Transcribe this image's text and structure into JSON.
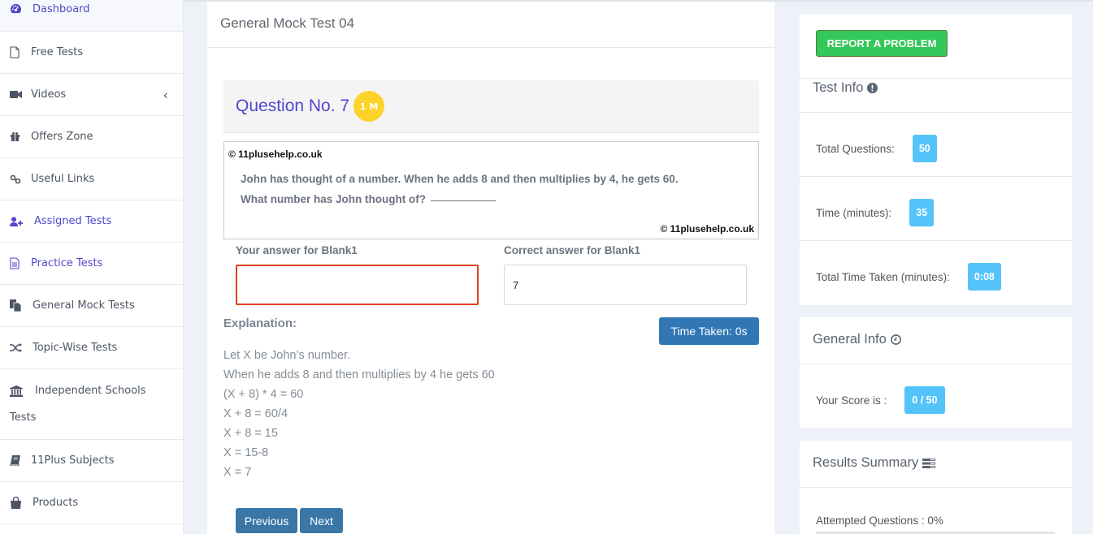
{
  "sidebar": {
    "items": [
      {
        "label": "Dashboard",
        "icon": "dashboard-icon",
        "active": true
      },
      {
        "label": "Free Tests",
        "icon": "file-icon"
      },
      {
        "label": "Videos",
        "icon": "video-camera-icon",
        "has_submenu": true
      },
      {
        "label": "Offers Zone",
        "icon": "gift-icon"
      },
      {
        "label": "Useful Links",
        "icon": "link-icon"
      },
      {
        "label": "Assigned Tests",
        "icon": "user-plus-icon",
        "active": true
      },
      {
        "label": "Practice Tests",
        "icon": "file-text-icon",
        "active": true
      },
      {
        "label": "General Mock Tests",
        "icon": "copy-files-icon"
      },
      {
        "label": "Topic-Wise Tests",
        "icon": "shuffle-icon"
      },
      {
        "label_line1": "Independent Schools",
        "label_line2": "Tests",
        "icon": "institution-icon"
      },
      {
        "label": "11Plus Subjects",
        "icon": "book-icon"
      },
      {
        "label": "Products",
        "icon": "shopping-bag-icon"
      }
    ]
  },
  "main": {
    "test_title": "General Mock Test 04",
    "question": {
      "title": "Question No. 7",
      "marks_badge": "1 M",
      "copyright_top": "© 11plusehelp.co.uk",
      "copyright_bottom": "© 11plusehelp.co.uk",
      "line1": "John has thought of a number. When he adds 8 and then multiplies by 4, he gets 60.",
      "line2": "What number has John thought of?"
    },
    "your_answer_label": "Your answer for Blank1",
    "your_answer_value": "",
    "correct_answer_label": "Correct answer for Blank1",
    "correct_answer_value": "7",
    "explanation_title": "Explanation:",
    "time_taken": "Time Taken: 0s",
    "explanation_lines": [
      "Let X be John’s number.",
      "When he adds 8 and then multiplies by 4 he gets 60",
      "(X + 8) * 4 = 60",
      "X + 8 = 60/4",
      "X + 8 = 15",
      "X = 15-8",
      "X = 7"
    ],
    "previous_label": "Previous",
    "next_label": "Next"
  },
  "right_panel": {
    "report_button": "REPORT A PROBLEM",
    "test_info": {
      "title": "Test Info",
      "total_questions_label": "Total Questions:",
      "total_questions_value": "50",
      "time_label": "Time (minutes):",
      "time_value": "35",
      "total_time_taken_label": "Total Time Taken (minutes):",
      "total_time_taken_value": "0:08"
    },
    "general_info": {
      "title": "General Info",
      "score_label": "Your Score is :",
      "score_value": "0 / 50"
    },
    "results_summary": {
      "title": "Results Summary",
      "attempted_label": "Attempted Questions : 0%",
      "attempted_percent": 0
    }
  },
  "colors": {
    "accent_purple": "#5147c9",
    "badge_yellow": "#fdd32a",
    "button_blue": "#3077b4",
    "report_green": "#34c759",
    "pill_blue": "#54c3fa",
    "error_red": "#e2401c"
  }
}
